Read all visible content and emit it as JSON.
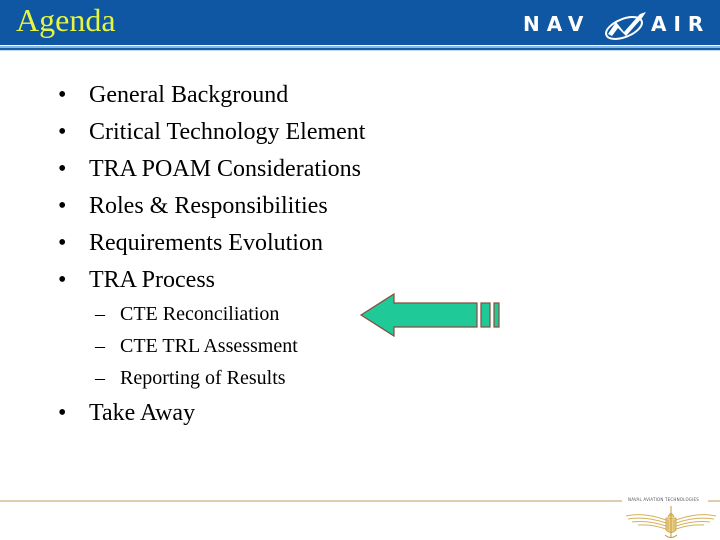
{
  "header": {
    "title": "Agenda",
    "title_color": "#e6f542",
    "bar_color": "#0f57a3",
    "logo": {
      "name": "navair-logo",
      "left_text": "NAV",
      "right_text": "AIR"
    }
  },
  "bullets": [
    {
      "label": "General Background"
    },
    {
      "label": "Critical Technology Element"
    },
    {
      "label": "TRA POAM Considerations"
    },
    {
      "label": "Roles & Responsibilities"
    },
    {
      "label": "Requirements Evolution"
    },
    {
      "label": "TRA Process"
    }
  ],
  "sub_bullets": [
    {
      "label": "CTE Reconciliation"
    },
    {
      "label": "CTE TRL Assessment"
    },
    {
      "label": "Reporting of Results"
    }
  ],
  "final_bullet": {
    "label": "Take Away"
  },
  "bullet_glyph": "•",
  "sub_bullet_glyph": "–",
  "pointer_arrow": {
    "icon": "left-arrow-icon",
    "points_to": "CTE Reconciliation",
    "fill_color": "#1fc998",
    "stroke_color": "#8a4b3c"
  },
  "footer": {
    "caption": "NAVAL AVIATION TECHNOLOGIES",
    "emblem": "naval-aviator-wings-icon",
    "line_color": "#ddcfae"
  }
}
